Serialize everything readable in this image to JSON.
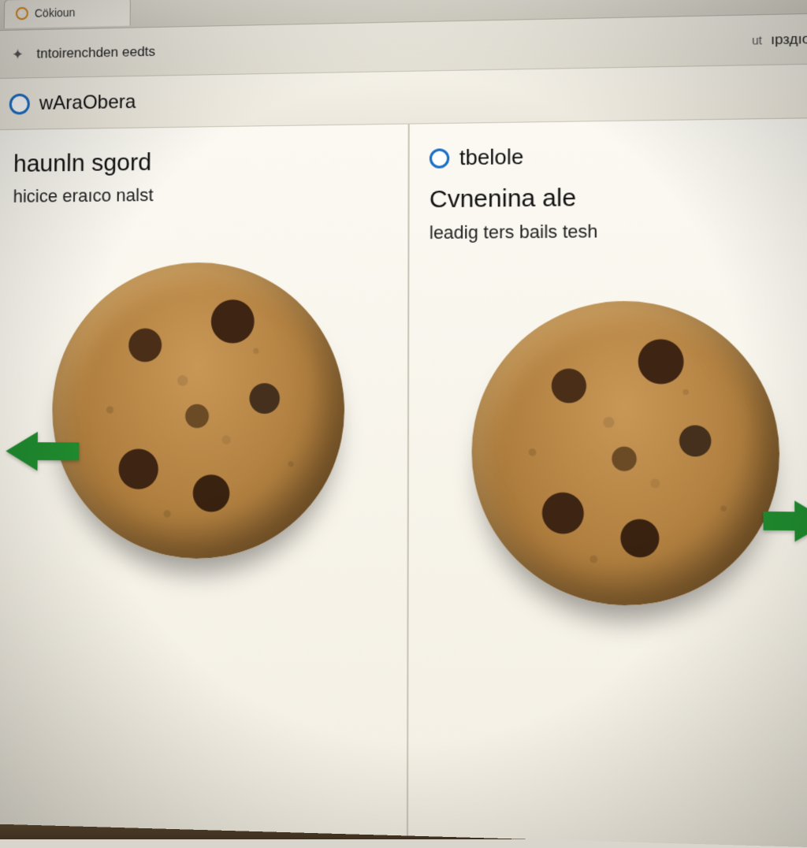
{
  "titlebar": {
    "tab_label": "Cökioun"
  },
  "toolbar": {
    "left_text": "tntoirenchden eedts",
    "right_small_label": "ut",
    "right_text": "ıpздıoıry"
  },
  "subheader": {
    "label": "wAraObera"
  },
  "panes": {
    "left": {
      "heading": "haunln sgord",
      "subtext": "hicice eraıco nalst"
    },
    "right": {
      "option_label": "tbelole",
      "heading": "Cvnenina ale",
      "subtext": "leadig ters bails tesh"
    }
  },
  "icons": {
    "tab": "globe-icon",
    "nav": "chevron-icon",
    "option": "radio-circle-icon",
    "arrow_left": "arrow-left-icon",
    "arrow_right": "arrow-right-icon"
  }
}
